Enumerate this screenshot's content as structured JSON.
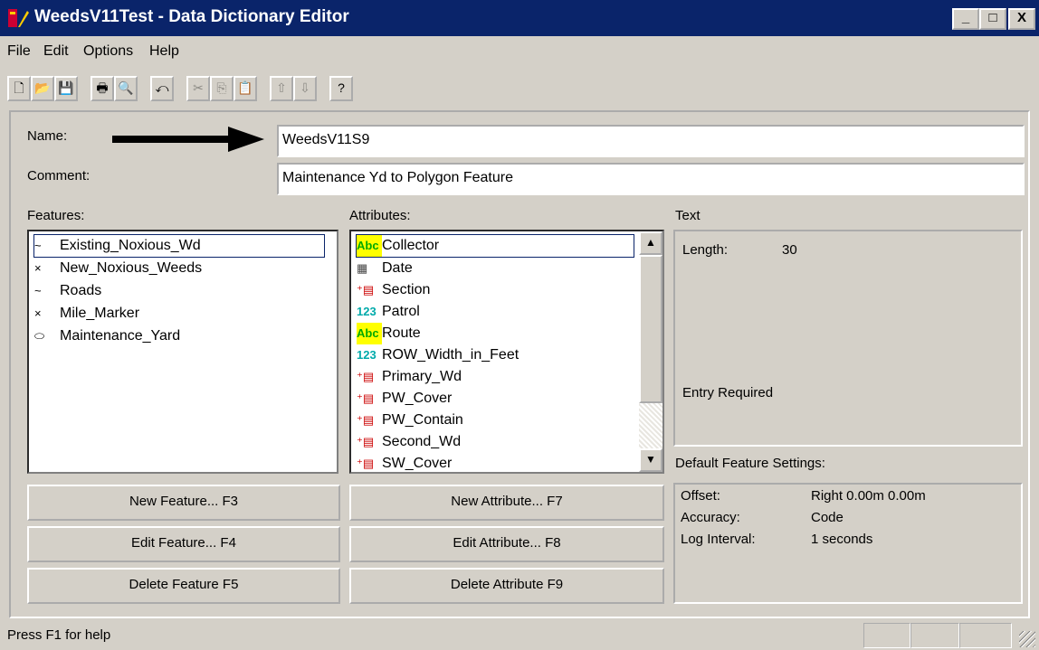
{
  "window": {
    "title": "WeedsV11Test - Data Dictionary Editor",
    "controls": {
      "minimize": "_",
      "maximize": "□",
      "close": "X"
    }
  },
  "menu": [
    "File",
    "Edit",
    "Options",
    "Help"
  ],
  "toolbar": {
    "icons": [
      "new-file-icon",
      "open-folder-icon",
      "save-icon",
      "print-icon",
      "print-preview-icon",
      "undo-icon",
      "cut-icon",
      "copy-icon",
      "paste-icon",
      "move-up-icon",
      "move-down-icon",
      "help-icon"
    ],
    "glyphs": [
      "🗋",
      "📂",
      "💾",
      "🖶",
      "🔍",
      "⤺",
      "✂",
      "⎘",
      "📋",
      "⇧",
      "⇩",
      "?"
    ]
  },
  "form": {
    "name_label": "Name:",
    "name_value": "WeedsV11S9",
    "comment_label": "Comment:",
    "comment_value": "Maintenance Yd to Polygon Feature"
  },
  "features": {
    "label": "Features:",
    "items": [
      {
        "icon": "line-feature-icon",
        "glyph": "~",
        "label": "Existing_Noxious_Wd"
      },
      {
        "icon": "point-feature-icon",
        "glyph": "×",
        "label": "New_Noxious_Weeds"
      },
      {
        "icon": "line-feature-icon",
        "glyph": "~",
        "label": "Roads"
      },
      {
        "icon": "point-feature-icon",
        "glyph": "×",
        "label": "Mile_Marker"
      },
      {
        "icon": "area-feature-icon",
        "glyph": "⬭",
        "label": "Maintenance_Yard"
      }
    ]
  },
  "attributes": {
    "label": "Attributes:",
    "items": [
      {
        "icon": "text-attribute-icon",
        "glyph": "Abc",
        "label": "Collector"
      },
      {
        "icon": "date-attribute-icon",
        "glyph": "▦",
        "label": "Date"
      },
      {
        "icon": "menu-attribute-icon",
        "glyph": "⁺▤",
        "label": "Section"
      },
      {
        "icon": "numeric-attribute-icon",
        "glyph": "123",
        "label": "Patrol"
      },
      {
        "icon": "text-attribute-icon",
        "glyph": "Abc",
        "label": "Route"
      },
      {
        "icon": "numeric-attribute-icon",
        "glyph": "123",
        "label": "ROW_Width_in_Feet"
      },
      {
        "icon": "menu-attribute-icon",
        "glyph": "⁺▤",
        "label": "Primary_Wd"
      },
      {
        "icon": "menu-attribute-icon",
        "glyph": "⁺▤",
        "label": "PW_Cover"
      },
      {
        "icon": "menu-attribute-icon",
        "glyph": "⁺▤",
        "label": "PW_Contain"
      },
      {
        "icon": "menu-attribute-icon",
        "glyph": "⁺▤",
        "label": "Second_Wd"
      },
      {
        "icon": "menu-attribute-icon",
        "glyph": "⁺▤",
        "label": "SW_Cover"
      }
    ]
  },
  "text_panel": {
    "heading": "Text",
    "length_label": "Length:",
    "length_value": "30",
    "entry": "Entry Required"
  },
  "defaults_panel": {
    "heading": "Default Feature Settings:",
    "rows": [
      {
        "label": "Offset:",
        "value": "Right 0.00m 0.00m"
      },
      {
        "label": "Accuracy:",
        "value": "Code"
      },
      {
        "label": "Log Interval:",
        "value": "1 seconds"
      }
    ]
  },
  "buttons": {
    "new_feature": "New Feature... F3",
    "edit_feature": "Edit Feature... F4",
    "delete_feature": "Delete Feature F5",
    "new_attribute": "New Attribute... F7",
    "edit_attribute": "Edit Attribute... F8",
    "delete_attribute": "Delete Attribute F9"
  },
  "status": "Press F1 for help"
}
